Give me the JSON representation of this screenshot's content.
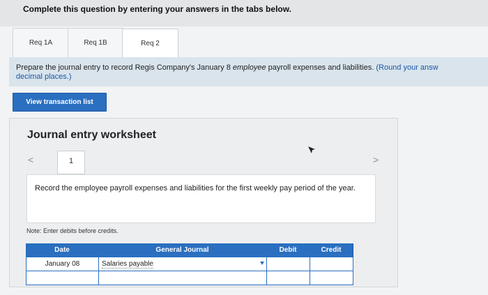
{
  "header": {
    "title": "Complete this question by entering your answers in the tabs below."
  },
  "tabs": [
    {
      "label": "Req 1A"
    },
    {
      "label": "Req 1B"
    },
    {
      "label": "Req 2"
    }
  ],
  "prompt": {
    "part1": "Prepare the journal entry to record Regis Company's January 8 ",
    "italic": "employee",
    "part2": " payroll expenses and liabilities. ",
    "blue1": "(Round your answ",
    "blue2": "decimal places.)"
  },
  "buttons": {
    "view_transactions": "View transaction list"
  },
  "worksheet": {
    "title": "Journal entry worksheet",
    "page": "1",
    "prev_glyph": "<",
    "next_glyph": ">",
    "instruction": "Record the employee payroll expenses and liabilities for the first weekly pay period of the year.",
    "note": "Note: Enter debits before credits."
  },
  "table": {
    "headers": [
      "Date",
      "General Journal",
      "Debit",
      "Credit"
    ],
    "rows": [
      {
        "date": "January 08",
        "account": "Salaries payable",
        "debit": "",
        "credit": ""
      },
      {
        "date": "",
        "account": "",
        "debit": "",
        "credit": ""
      }
    ]
  },
  "colors": {
    "accent": "#2a6fc0",
    "prompt_bg": "#d9e4ec",
    "round_note": "#1a57a7"
  }
}
